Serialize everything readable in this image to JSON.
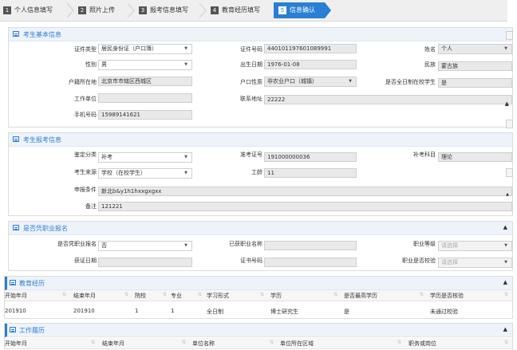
{
  "steps": [
    {
      "num": "1",
      "label": "个人信息填写"
    },
    {
      "num": "2",
      "label": "照片上传"
    },
    {
      "num": "3",
      "label": "报考信息填写"
    },
    {
      "num": "4",
      "label": "教育经历填写"
    },
    {
      "num": "5",
      "label": "信息确认"
    }
  ],
  "basic": {
    "title": "考生基本信息",
    "id_type_label": "证件类型",
    "id_type_value": "居民身份证（户口簿）",
    "id_no_label": "证件号码",
    "id_no_value": "440101197601089991",
    "name_label": "姓名",
    "name_value": "个人",
    "gender_label": "性别",
    "gender_value": "男",
    "birth_label": "出生日期",
    "birth_value": "1976-01-08",
    "nation_label": "民族",
    "nation_value": "蒙古族",
    "hukou_place_label": "户籍所在地",
    "hukou_place_value": "北京市市辖区西城区",
    "hukou_nature_label": "户口性质",
    "hukou_nature_value": "非农业户口（城镇）",
    "fulltime_label": "是否全日制在校学生",
    "fulltime_value": "是",
    "work_unit_label": "工作单位",
    "work_unit_value": "",
    "address_label": "联系地址",
    "address_value": "22222",
    "phone_label": "手机号码",
    "phone_value": "15989141621"
  },
  "exam": {
    "title": "考生报考信息",
    "category_label": "鉴定分类",
    "category_value": "补考",
    "ticket_label": "准考证号",
    "ticket_value": "191000000036",
    "makeup_label": "补考科目",
    "makeup_value": "理论",
    "source_label": "考生来源",
    "source_value": "学校（在校学生）",
    "years_label": "工龄",
    "years_value": "11",
    "condition_label": "申报条件",
    "condition_value": "新北b&y1h1hxxgxgxx",
    "remark_label": "备注",
    "remark_value": "121221"
  },
  "vocational": {
    "title": "是否凭职业报名",
    "by_cert_label": "是否凭职业报名",
    "by_cert_value": "否",
    "cert_name_label": "已获职业名称",
    "cert_name_value": "",
    "level_label": "职业等级",
    "level_placeholder": "请选择",
    "date_label": "获证日期",
    "date_value": "",
    "cert_no_label": "证书号码",
    "cert_no_value": "",
    "verified_label": "职业是否校验",
    "verified_placeholder": "请选择"
  },
  "education": {
    "title": "教育经历",
    "columns": [
      "开始年月",
      "结束年月",
      "院校",
      "专业",
      "学习形式",
      "学历",
      "是否最高学历",
      "学历是否核验"
    ],
    "rows": [
      [
        "201910",
        "201910",
        "1",
        "1",
        "全日制",
        "博士研究生",
        "是",
        "未通过校验"
      ]
    ]
  },
  "work": {
    "title": "工作履历",
    "columns": [
      "开始年月",
      "结束年月",
      "单位名称",
      "单位所在区域",
      "职务或岗位"
    ]
  },
  "icons": {
    "panel_icon": "list-icon",
    "collapse_icon": "chevron-up-icon",
    "select_icon": "caret-down-icon"
  },
  "colors": {
    "accent": "#2a7fd4",
    "header_bg": "#eef3fa",
    "input_bg": "#e9e9e9"
  }
}
